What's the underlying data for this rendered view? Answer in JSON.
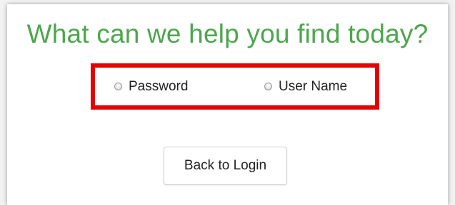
{
  "page": {
    "title": "What can we help you find today?",
    "title_color": "#4ca64c",
    "highlight_color": "#e60000"
  },
  "options": {
    "password_label": "Password",
    "username_label": "User Name"
  },
  "actions": {
    "back_label": "Back to Login"
  }
}
